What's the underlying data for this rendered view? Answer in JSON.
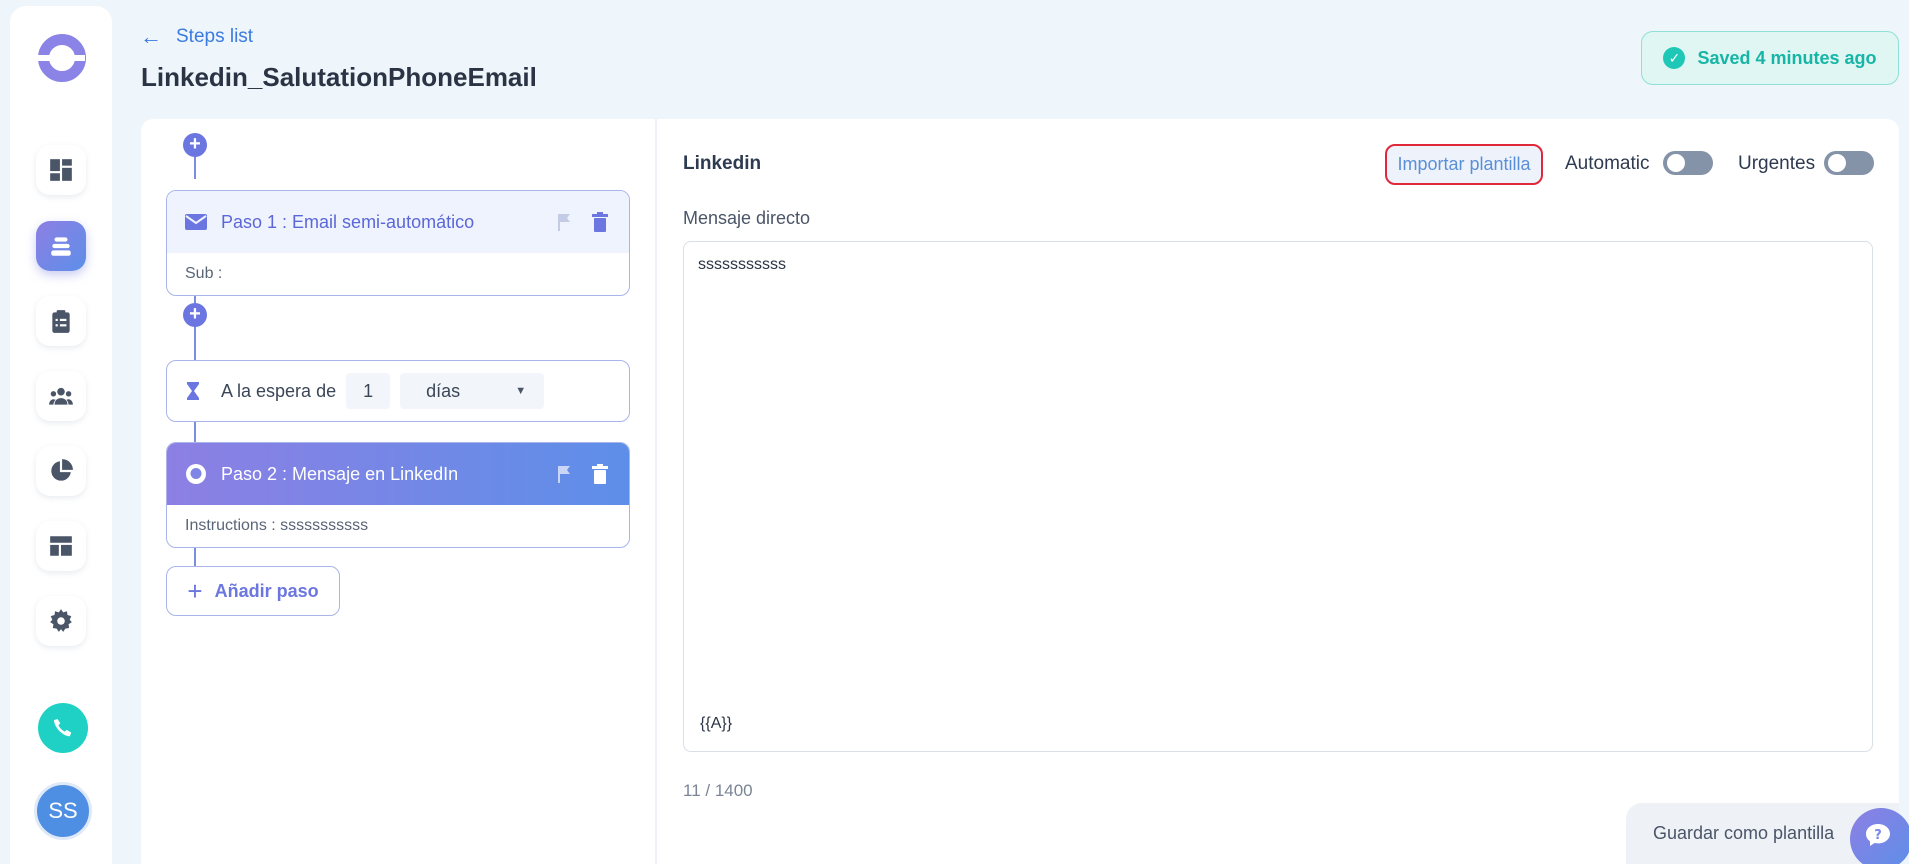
{
  "header": {
    "back_label": "Steps list",
    "title": "Linkedin_SalutationPhoneEmail",
    "saved_status": "Saved 4 minutes ago"
  },
  "sidebar": {
    "items": [
      {
        "name": "dashboard",
        "icon": "dashboard-icon",
        "active": false
      },
      {
        "name": "campaigns",
        "icon": "stack-icon",
        "active": true
      },
      {
        "name": "tasks",
        "icon": "clipboard-icon",
        "active": false
      },
      {
        "name": "contacts",
        "icon": "people-icon",
        "active": false
      },
      {
        "name": "reports",
        "icon": "pie-chart-icon",
        "active": false
      },
      {
        "name": "templates",
        "icon": "layout-icon",
        "active": false
      },
      {
        "name": "settings",
        "icon": "gear-icon",
        "active": false
      }
    ],
    "avatar_initials": "SS"
  },
  "steps": [
    {
      "title": "Paso 1 : Email semi-automático",
      "body": "Sub :",
      "icon": "mail-icon",
      "selected": false
    },
    {
      "title": "Paso 2 : Mensaje en LinkedIn",
      "body": "Instructions : sssssssssss",
      "icon": "chat-bubble-icon",
      "selected": true
    }
  ],
  "wait": {
    "label": "A la espera de",
    "amount": "1",
    "unit": "días"
  },
  "add_step_label": "Añadir paso",
  "editor": {
    "channel_title": "Linkedin",
    "import_template_label": "Importar plantilla",
    "automatic_label": "Automatic",
    "urgent_label": "Urgentes",
    "message_label": "Mensaje directo",
    "message_text": "sssssssssss",
    "variable_tag": "{{A}}",
    "char_count": "11 / 1400",
    "save_template_label": "Guardar como plantilla"
  },
  "colors": {
    "accent": "#6b76e0",
    "gradient_start": "#8d7fe4",
    "gradient_end": "#5d8fe8",
    "success": "#17b5a6",
    "highlight_border": "#e0283a"
  }
}
